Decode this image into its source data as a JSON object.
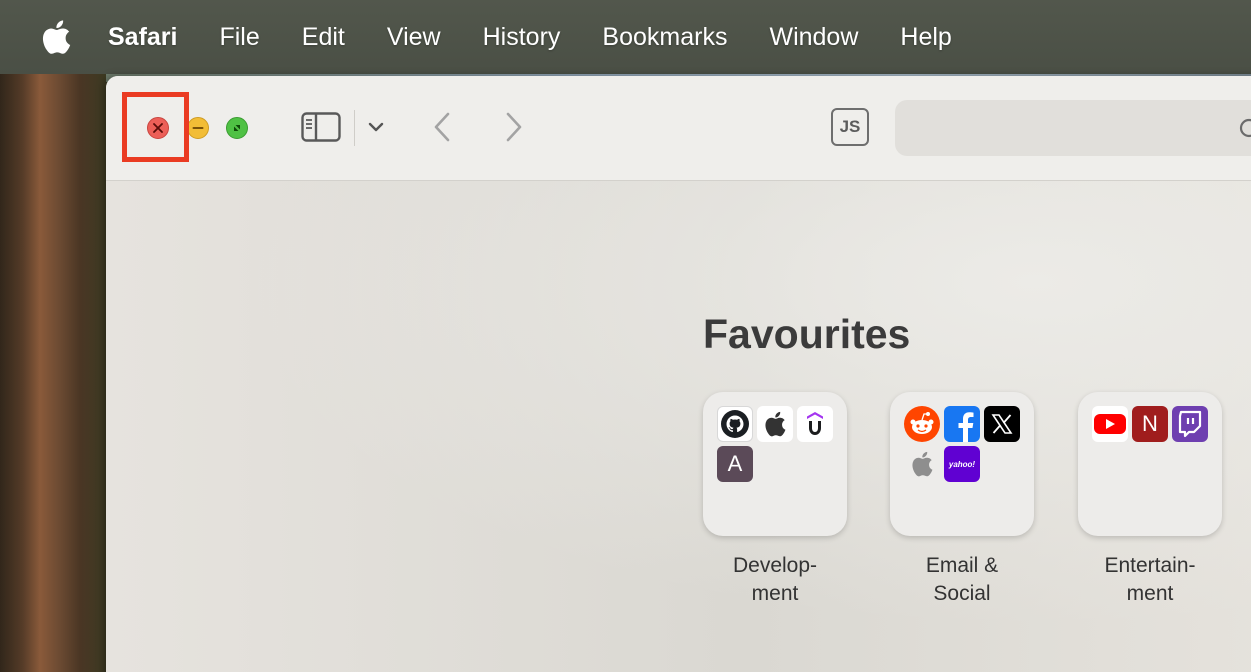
{
  "menubar": {
    "apple_icon": "apple-logo-icon",
    "app_name": "Safari",
    "items": [
      "File",
      "Edit",
      "View",
      "History",
      "Bookmarks",
      "Window",
      "Help"
    ]
  },
  "toolbar": {
    "js_label": "JS",
    "address_placeholder": "",
    "icons": [
      "close-icon",
      "minimize-icon",
      "fullscreen-icon",
      "sidebar-icon",
      "chevron-down-icon",
      "back-icon",
      "forward-icon",
      "search-icon"
    ]
  },
  "favourites": {
    "title": "Favourites",
    "folders": [
      {
        "caption_lines": [
          "Develop-",
          "ment"
        ],
        "icons": [
          "github-icon",
          "apple-icon",
          "udemy-icon",
          "a-letter-icon"
        ],
        "a_letter": "A"
      },
      {
        "caption_lines": [
          "Email &",
          "Social"
        ],
        "icons": [
          "reddit-icon",
          "facebook-icon",
          "x-icon",
          "apple-icon",
          "yahoo-icon"
        ],
        "yahoo_text": "yahoo!"
      },
      {
        "caption_lines": [
          "Entertain-",
          "ment"
        ],
        "icons": [
          "youtube-icon",
          "netflix-icon",
          "twitch-icon"
        ],
        "netflix_letter": "N"
      }
    ]
  },
  "colors": {
    "close": "#ec5f58",
    "minimize": "#f2bd36",
    "fullscreen": "#4fc144",
    "highlight": "#ea3b22"
  }
}
